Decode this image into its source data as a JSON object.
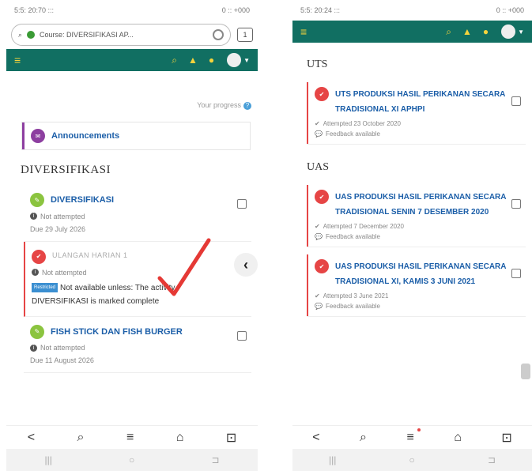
{
  "left": {
    "status": {
      "time": "5:5: 20:70 :::",
      "right": "0 :: +000"
    },
    "url": "Course: DIVERSIFIKASI AP...",
    "tabs_count": "1",
    "nav_icons": [
      "menu-icon",
      "search-icon",
      "bell-icon",
      "chat-icon",
      "avatar"
    ],
    "progress_label": "Your progress",
    "announcements": "Announcements",
    "section": "DIVERSIFIKASI",
    "activities": [
      {
        "title": "DIVERSIFIKASI",
        "status": "Not attempted",
        "due": "Due 29 July 2026"
      },
      {
        "title": "ULANGAN HARIAN 1",
        "status": "Not attempted",
        "restricted_tag": "Restricted",
        "restriction": "Not available unless: The activity DIVERSIFIKASI is marked complete"
      },
      {
        "title": "FISH STICK DAN FISH BURGER",
        "status": "Not attempted",
        "due": "Due 11 August 2026"
      }
    ],
    "bottom_nav": [
      "<",
      "⌕",
      "≡",
      "⌂",
      "⊡"
    ],
    "system_nav": [
      "|||",
      "○",
      "⊐"
    ],
    "colors": {
      "navbar": "#116f62",
      "accent": "#e64545"
    }
  },
  "right": {
    "status": {
      "time": "5:5: 20:24 :::",
      "right": "0 :: +000"
    },
    "sections": [
      {
        "title": "UTS",
        "items": [
          {
            "title": "UTS PRODUKSI HASIL PERIKANAN SECARA TRADISIONAL XI APHPI",
            "attempted": "Attempted 23 October 2020",
            "feedback": "Feedback available"
          }
        ]
      },
      {
        "title": "UAS",
        "items": [
          {
            "title": "UAS PRODUKSI HASIL PERIKANAN SECARA TRADISIONAL SENIN 7 DESEMBER 2020",
            "attempted": "Attempted 7 December 2020",
            "feedback": "Feedback available"
          },
          {
            "title": "UAS PRODUKSI HASIL PERIKANAN SECARA TRADISIONAL XI, KAMIS 3 JUNI 2021",
            "attempted": "Attempted 3 June 2021",
            "feedback": "Feedback available"
          }
        ]
      }
    ],
    "bottom_nav": [
      "<",
      "⌕",
      "≡",
      "⌂",
      "⊡"
    ],
    "system_nav": [
      "|||",
      "○",
      "⊐"
    ]
  }
}
